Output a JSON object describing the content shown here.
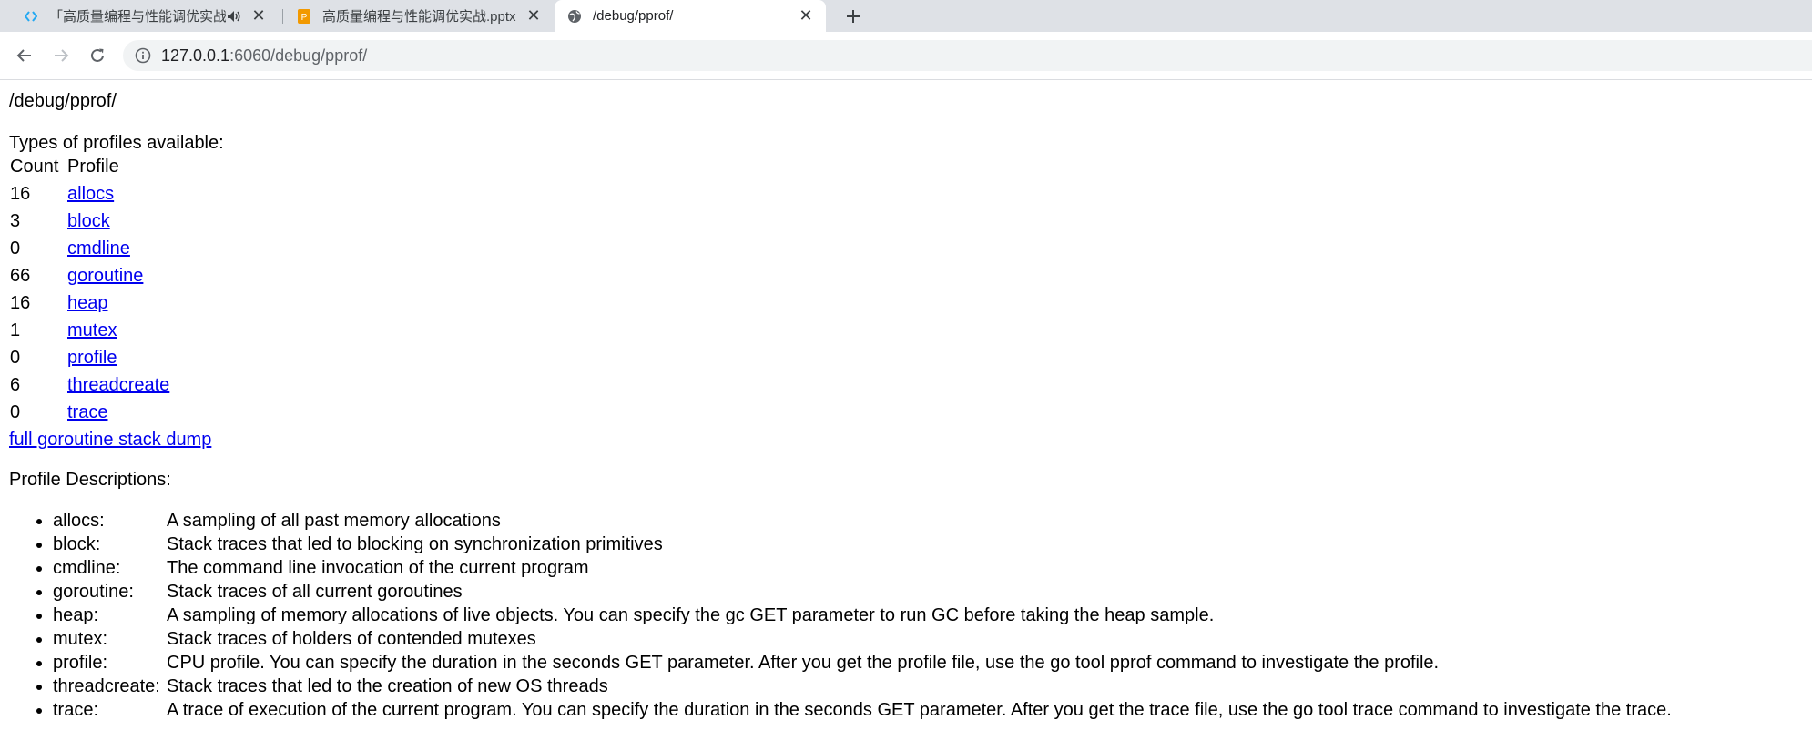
{
  "browser": {
    "tabs": [
      {
        "title": "「高质量编程与性能调优实战」",
        "active": false,
        "favicon": "code-brackets-icon",
        "audio": true
      },
      {
        "title": "高质量编程与性能调优实战.pptx",
        "active": false,
        "favicon": "presentation-file-icon",
        "audio": false
      },
      {
        "title": "/debug/pprof/",
        "active": true,
        "favicon": "globe-icon",
        "audio": false
      }
    ],
    "address_bar": {
      "host": "127.0.0.1",
      "path": ":6060/debug/pprof/"
    },
    "colors": {
      "tabstrip": "#dee1e6",
      "active_tab": "#ffffff",
      "omnibox": "#f1f3f4",
      "pptx_favicon": "#f29900",
      "vscode_favicon": "#23a8f2"
    }
  },
  "page": {
    "title": "/debug/pprof/",
    "types_heading": "Types of profiles available:",
    "table_headers": {
      "count": "Count",
      "profile": "Profile"
    },
    "profiles": [
      {
        "count": "16",
        "name": "allocs"
      },
      {
        "count": "3",
        "name": "block"
      },
      {
        "count": "0",
        "name": "cmdline"
      },
      {
        "count": "66",
        "name": "goroutine"
      },
      {
        "count": "16",
        "name": "heap"
      },
      {
        "count": "1",
        "name": "mutex"
      },
      {
        "count": "0",
        "name": "profile"
      },
      {
        "count": "6",
        "name": "threadcreate"
      },
      {
        "count": "0",
        "name": "trace"
      }
    ],
    "full_dump_link": "full goroutine stack dump",
    "descriptions_heading": "Profile Descriptions:",
    "descriptions": [
      {
        "name": "allocs:",
        "text": "A sampling of all past memory allocations"
      },
      {
        "name": "block:",
        "text": "Stack traces that led to blocking on synchronization primitives"
      },
      {
        "name": "cmdline:",
        "text": "The command line invocation of the current program"
      },
      {
        "name": "goroutine:",
        "text": "Stack traces of all current goroutines"
      },
      {
        "name": "heap:",
        "text": "A sampling of memory allocations of live objects. You can specify the gc GET parameter to run GC before taking the heap sample."
      },
      {
        "name": "mutex:",
        "text": "Stack traces of holders of contended mutexes"
      },
      {
        "name": "profile:",
        "text": "CPU profile. You can specify the duration in the seconds GET parameter. After you get the profile file, use the go tool pprof command to investigate the profile."
      },
      {
        "name": "threadcreate:",
        "text": "Stack traces that led to the creation of new OS threads"
      },
      {
        "name": "trace:",
        "text": "A trace of execution of the current program. You can specify the duration in the seconds GET parameter. After you get the trace file, use the go tool trace command to investigate the trace."
      }
    ],
    "link_color": "#0000ee"
  }
}
